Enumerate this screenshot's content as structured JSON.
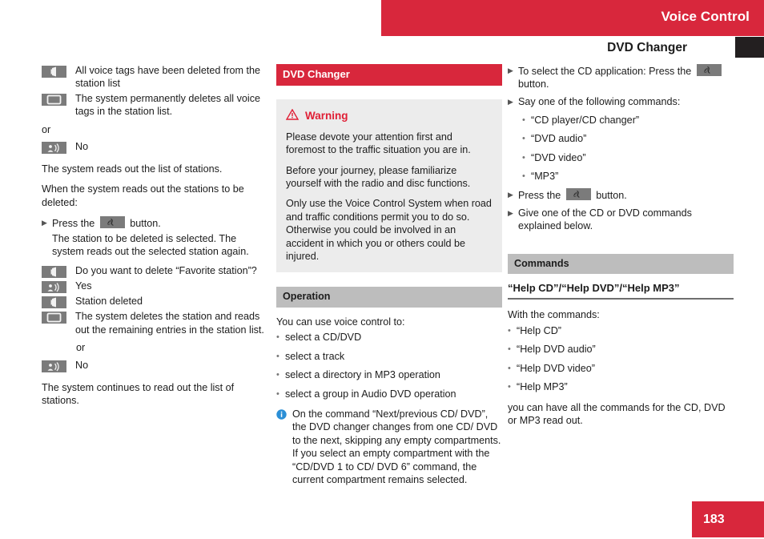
{
  "header": {
    "title": "Voice Control",
    "subtitle": "DVD Changer"
  },
  "footer": {
    "page_number": "183"
  },
  "colors": {
    "brand_red": "#d8273c",
    "warning_red": "#e01f35",
    "grey_bar": "#bdbdbd",
    "warn_box_bg": "#ececec",
    "badge_grey": "#7b7b7b",
    "info_blue": "#2b8fd6",
    "black_tab": "#231f20"
  },
  "left_column": {
    "dialog_1": [
      {
        "icon": "system-voice-output-icon",
        "text": "All voice tags have been deleted from the station list"
      },
      {
        "icon": "display-screen-icon",
        "text": "The system permanently deletes all voice tags in the station list."
      }
    ],
    "or_1": "or",
    "dialog_2": [
      {
        "icon": "user-speaks-icon",
        "text": "No"
      }
    ],
    "para_1": "The system reads out the list of stations.",
    "para_2": "When the system reads out the stations to be deleted:",
    "step_1": {
      "prefix": "Press the",
      "icon": "voice-control-button-icon",
      "suffix": "button.",
      "detail": "The station to be deleted is selected. The system reads out the selected station again."
    },
    "dialog_3": [
      {
        "icon": "system-voice-output-icon",
        "text": "Do you want to delete “Favorite station”?"
      },
      {
        "icon": "user-speaks-icon",
        "text": "Yes"
      },
      {
        "icon": "system-voice-output-icon",
        "text": "Station deleted"
      },
      {
        "icon": "display-screen-icon",
        "text": "The system deletes the station and reads out the remaining entries in the station list."
      }
    ],
    "or_2": "or",
    "dialog_4": [
      {
        "icon": "user-speaks-icon",
        "text": "No"
      }
    ],
    "para_3": "The system continues to read out the list of stations."
  },
  "middle_column": {
    "section_title": "DVD Changer",
    "warning": {
      "icon": "warning-triangle-icon",
      "label": "Warning",
      "paragraphs": [
        "Please devote your attention first and foremost to the traffic situation you are in.",
        "Before your journey, please familiarize yourself with the radio and disc functions.",
        "Only use the Voice Control System when road and traffic conditions permit you to do so. Otherwise you could be involved in an accident in which you or others could be injured."
      ]
    },
    "operation": {
      "title": "Operation",
      "intro": "You can use voice control to:",
      "bullets": [
        "select a CD/DVD",
        "select a track",
        "select a directory in MP3 operation",
        "select a group in Audio DVD operation"
      ],
      "note": {
        "icon": "info-circle-icon",
        "text": "On the command “Next/previous CD/ DVD”, the DVD changer changes from one CD/ DVD to the next, skipping any empty compartments. If you select an empty compartment with the “CD/DVD 1 to CD/ DVD 6” command, the current compartment remains selected."
      }
    }
  },
  "right_column": {
    "steps": [
      {
        "prefix": "To select the CD application: Press the",
        "icon": "voice-control-button-icon",
        "suffix": "button."
      },
      {
        "prefix": "Say one of the following commands:",
        "icon": null,
        "suffix": ""
      }
    ],
    "commands_list": [
      "“CD player/CD changer”",
      "“DVD audio”",
      "“DVD video”",
      "“MP3”"
    ],
    "step_press": {
      "prefix": "Press the",
      "icon": "voice-control-button-icon",
      "suffix": "button."
    },
    "step_give": "Give one of the CD or DVD commands explained below.",
    "commands": {
      "title": "Commands",
      "sub_head": "“Help CD”/“Help DVD”/“Help MP3”",
      "intro": "With the commands:",
      "bullets": [
        "“Help CD”",
        "“Help DVD audio”",
        "“Help DVD video”",
        "“Help MP3”"
      ],
      "outro": "you can have all the commands for the CD, DVD or MP3 read out."
    }
  }
}
